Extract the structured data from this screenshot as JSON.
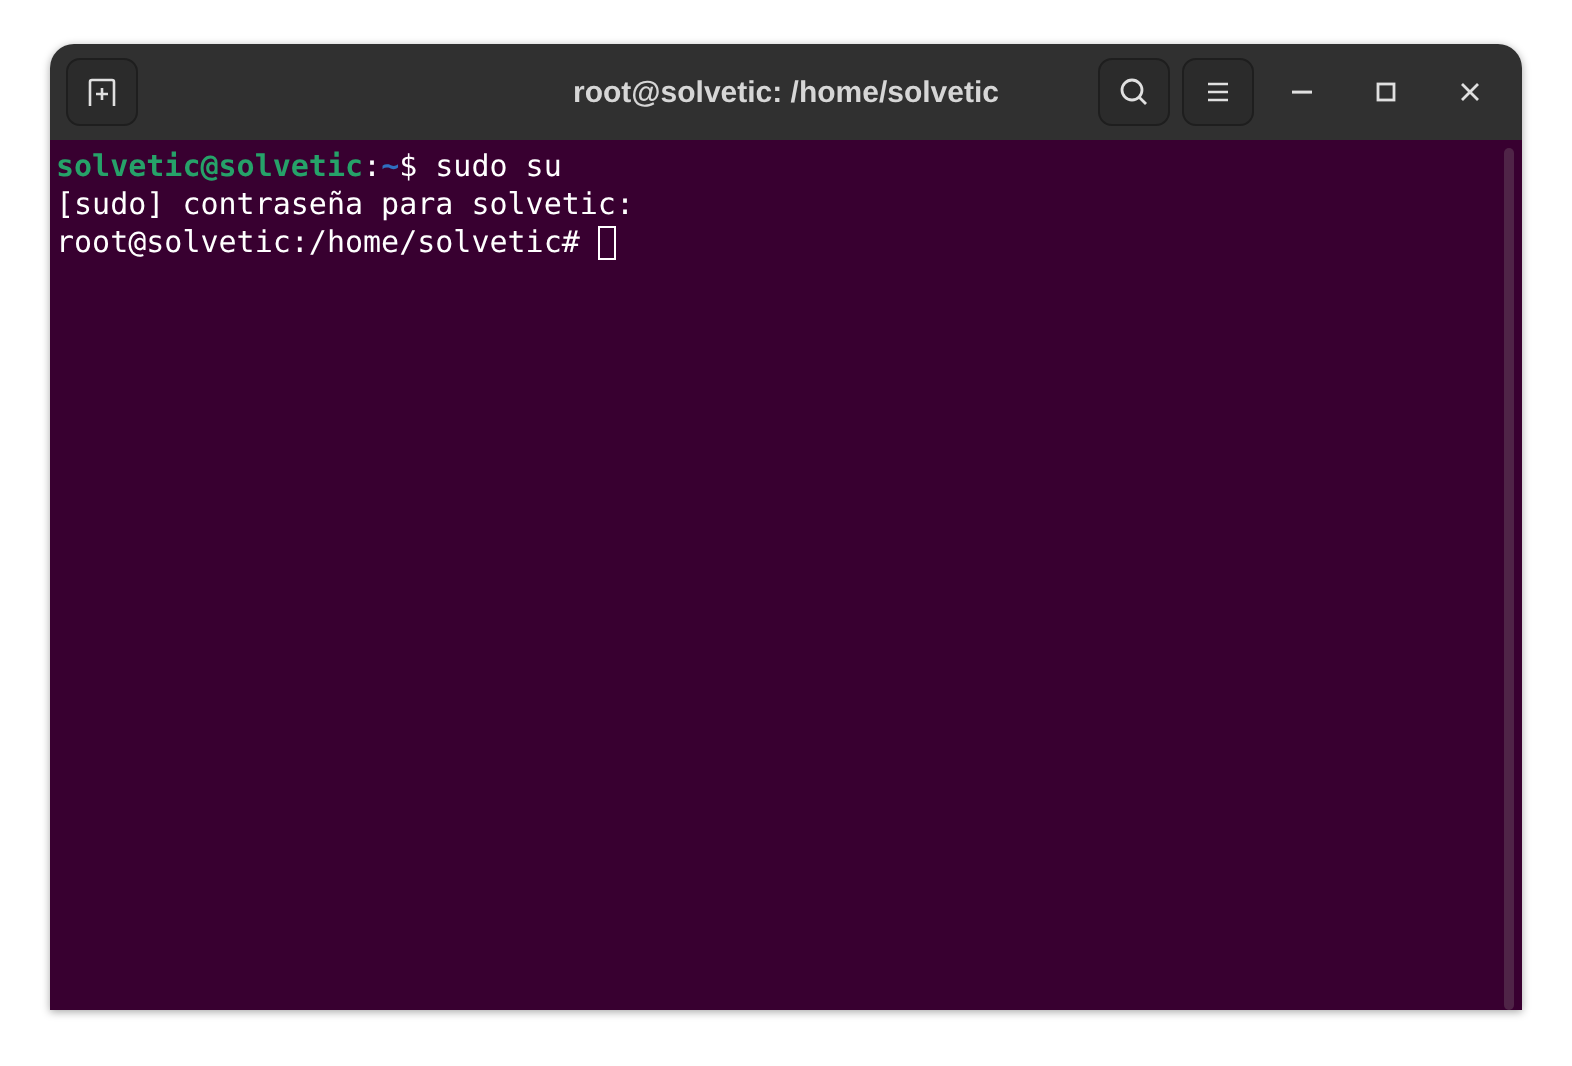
{
  "window": {
    "title": "root@solvetic: /home/solvetic"
  },
  "terminal": {
    "lines": [
      {
        "segments": [
          {
            "kind": "user",
            "text": "solvetic@solvetic"
          },
          {
            "kind": "plain",
            "text": ":"
          },
          {
            "kind": "path",
            "text": "~"
          },
          {
            "kind": "plain",
            "text": "$ sudo su"
          }
        ],
        "cursor": false
      },
      {
        "segments": [
          {
            "kind": "plain",
            "text": "[sudo] contraseña para solvetic:"
          }
        ],
        "cursor": false
      },
      {
        "segments": [
          {
            "kind": "plain",
            "text": "root@solvetic:/home/solvetic# "
          }
        ],
        "cursor": true
      }
    ]
  }
}
